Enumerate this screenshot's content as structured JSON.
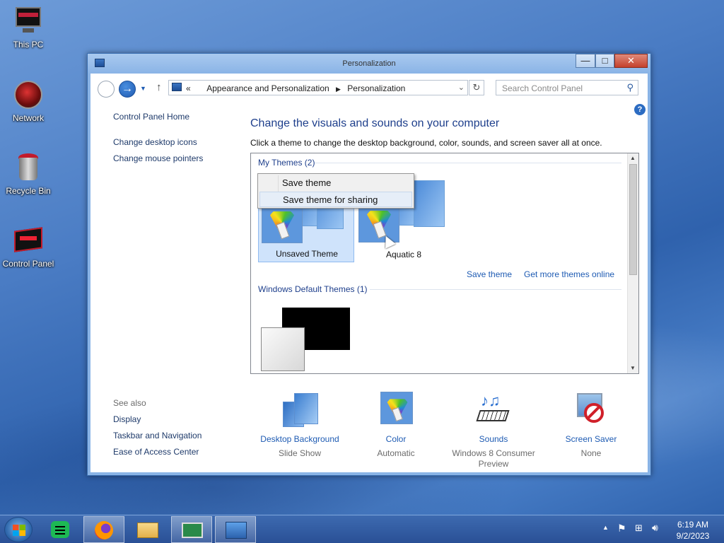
{
  "desktop": {
    "icons": [
      {
        "label": "This PC"
      },
      {
        "label": "Network"
      },
      {
        "label": "Recycle Bin"
      },
      {
        "label": "Control Panel"
      }
    ]
  },
  "window": {
    "title": "Personalization",
    "controls": {
      "minimize": "—",
      "maximize": "□",
      "close": "✕"
    }
  },
  "address_bar": {
    "chevron": "«",
    "crumbs": [
      "Appearance and Personalization",
      "Personalization"
    ],
    "search_placeholder": "Search Control Panel"
  },
  "left_pane": {
    "home": "Control Panel Home",
    "links": [
      "Change desktop icons",
      "Change mouse pointers"
    ],
    "see_also_label": "See also",
    "see_also": [
      "Display",
      "Taskbar and Navigation",
      "Ease of Access Center"
    ]
  },
  "main": {
    "heading": "Change the visuals and sounds on your computer",
    "subheading": "Click a theme to change the desktop background, color, sounds, and screen saver all at once.",
    "my_themes_header": "My Themes (2)",
    "my_themes": [
      {
        "name": "Unsaved Theme",
        "selected": true
      },
      {
        "name": "Aquatic 8",
        "selected": false
      }
    ],
    "save_theme_link": "Save theme",
    "get_more_link": "Get more themes online",
    "default_themes_header": "Windows Default Themes (1)"
  },
  "context_menu": {
    "items": [
      {
        "label": "Save theme",
        "highlighted": false
      },
      {
        "label": "Save theme for sharing",
        "highlighted": true
      }
    ]
  },
  "bottom_bar": [
    {
      "link": "Desktop Background",
      "sub": "Slide Show",
      "icon": "desktop-background-icon"
    },
    {
      "link": "Color",
      "sub": "Automatic",
      "icon": "color-icon"
    },
    {
      "link": "Sounds",
      "sub": "Windows 8 Consumer Preview",
      "icon": "sounds-icon"
    },
    {
      "link": "Screen Saver",
      "sub": "None",
      "icon": "screen-saver-icon"
    }
  ],
  "taskbar": {
    "pinned": [
      "firefox",
      "file-explorer",
      "app-window",
      "control-panel"
    ],
    "clock_time": "6:19 AM",
    "clock_date": "9/2/2023"
  }
}
